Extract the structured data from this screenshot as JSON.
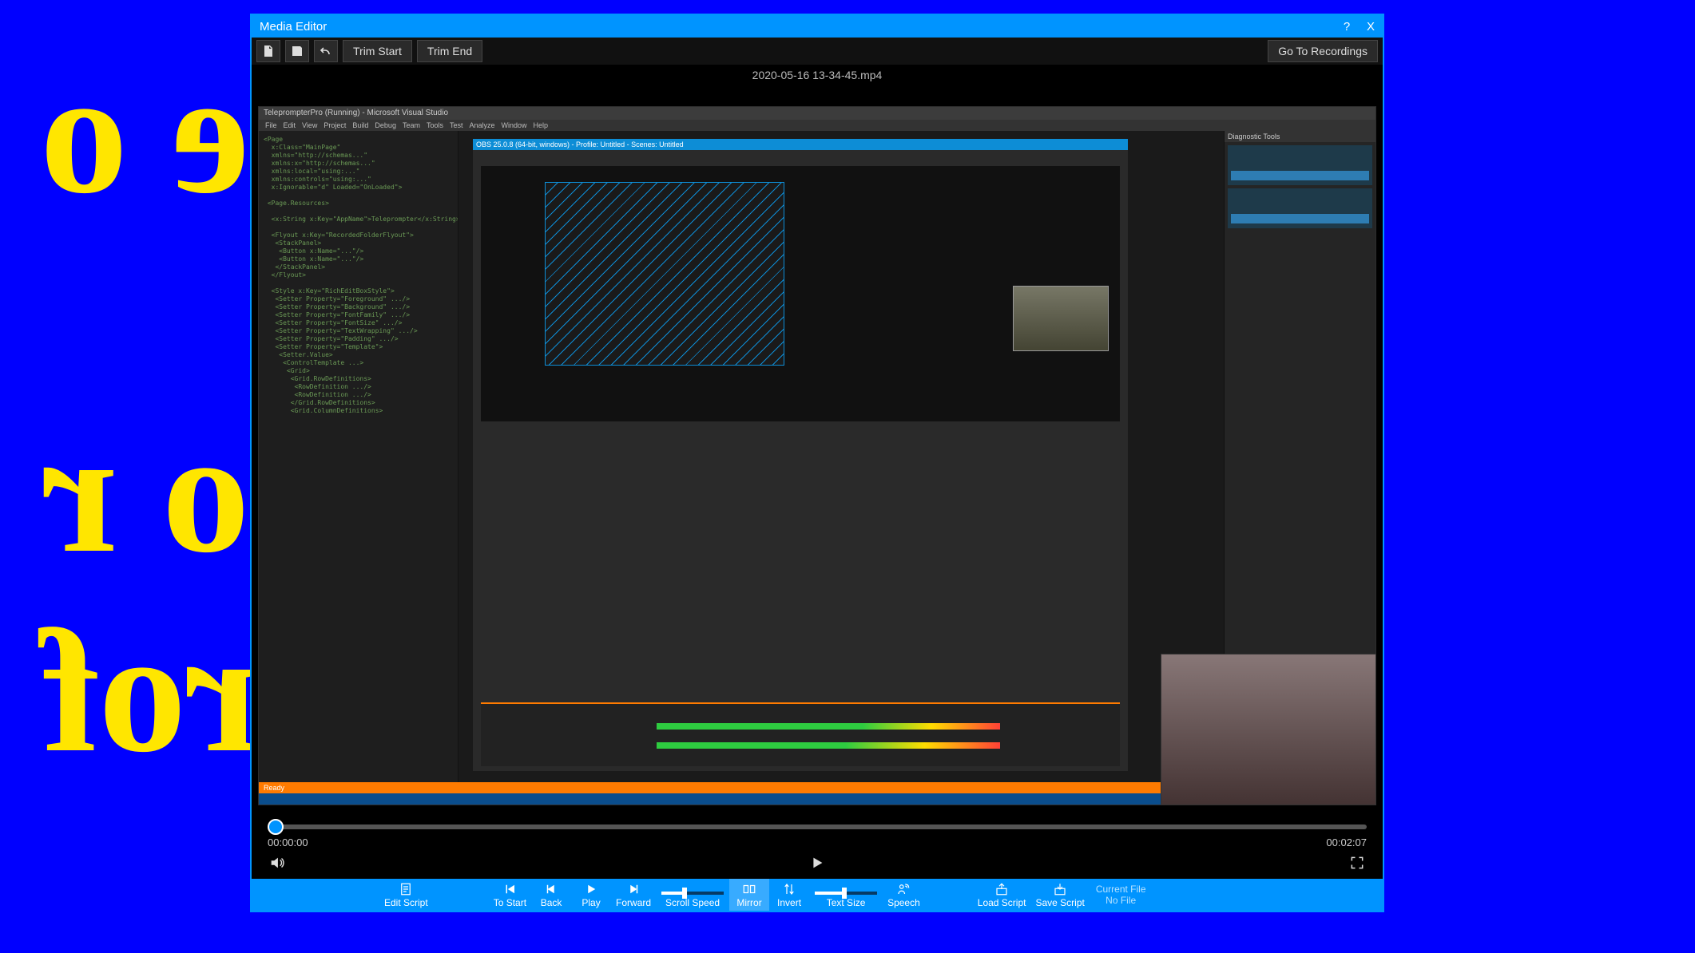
{
  "background_text": {
    "line1": "Tele o",
    "line2": "Scro r",
    "line3": "Prof "
  },
  "window": {
    "title": "Media Editor",
    "help_label": "?",
    "close_label": "X"
  },
  "toolbar": {
    "trim_start": "Trim Start",
    "trim_end": "Trim End",
    "go_to_recordings": "Go To Recordings"
  },
  "filename": "2020-05-16 13-34-45.mp4",
  "preview": {
    "vs_title": "TeleprompterPro (Running) - Microsoft Visual Studio",
    "vs_menus": [
      "File",
      "Edit",
      "View",
      "Project",
      "Build",
      "Debug",
      "Team",
      "Tools",
      "Test",
      "Analyze",
      "Window",
      "Help"
    ],
    "obs_title": "OBS 25.0.8 (64-bit, windows) - Profile: Untitled - Scenes: Untitled",
    "diag_title": "Diagnostic Tools",
    "vs_status": "Ready",
    "code_snippet": "<Page\n  x:Class=\"MainPage\"\n  xmlns=\"http://schemas...\"\n  xmlns:x=\"http://schemas...\"\n  xmlns:local=\"using:...\"\n  xmlns:controls=\"using:...\"\n  x:Ignorable=\"d\" Loaded=\"OnLoaded\">\n\n <Page.Resources>\n\n  <x:String x:Key=\"AppName\">Teleprompter</x:String>\n\n  <Flyout x:Key=\"RecordedFolderFlyout\">\n   <StackPanel>\n    <Button x:Name=\"...\"/>\n    <Button x:Name=\"...\"/>\n   </StackPanel>\n  </Flyout>\n\n  <Style x:Key=\"RichEditBoxStyle\">\n   <Setter Property=\"Foreground\" .../>\n   <Setter Property=\"Background\" .../>\n   <Setter Property=\"FontFamily\" .../>\n   <Setter Property=\"FontSize\" .../>\n   <Setter Property=\"TextWrapping\" .../>\n   <Setter Property=\"Padding\" .../>\n   <Setter Property=\"Template\">\n    <Setter.Value>\n     <ControlTemplate ...>\n      <Grid>\n       <Grid.RowDefinitions>\n        <RowDefinition .../>\n        <RowDefinition .../>\n       </Grid.RowDefinitions>\n       <Grid.ColumnDefinitions>\n"
  },
  "playback": {
    "current_time": "00:00:00",
    "total_time": "00:02:07"
  },
  "dock": {
    "edit_script": "Edit Script",
    "to_start": "To Start",
    "back": "Back",
    "play": "Play",
    "forward": "Forward",
    "scroll_speed": "Scroll Speed",
    "mirror": "Mirror",
    "invert": "Invert",
    "text_size": "Text Size",
    "speech": "Speech",
    "load_script": "Load Script",
    "save_script": "Save Script",
    "current_file_label": "Current File",
    "current_file_value": "No File"
  },
  "colors": {
    "blue_bg": "#0000ff",
    "accent": "#0094ff",
    "yellow": "#ffe600",
    "orange": "#ff7b00"
  }
}
